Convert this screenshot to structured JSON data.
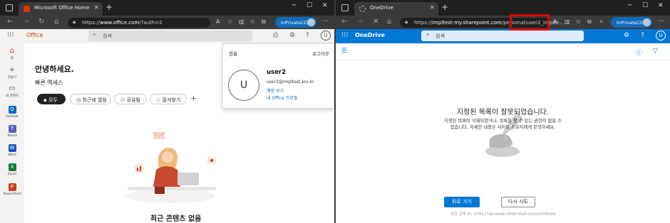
{
  "left_window": {
    "tab_title": "Microsoft Office Home",
    "url_prefix": "https://",
    "url_host": "www.office.com",
    "url_rest": "/?auth=2",
    "inprivate_label": "InPrivate(2)",
    "header": {
      "brand": "Office",
      "search_placeholder": "검색",
      "avatar_initial": "U"
    },
    "rail": [
      {
        "label": "홈",
        "icon": "home-icon",
        "color": "#d83b01"
      },
      {
        "label": "만들기",
        "icon": "add-icon",
        "color": "#555555"
      },
      {
        "label": "내 콘텐츠",
        "icon": "folder-icon",
        "color": "#555555"
      },
      {
        "label": "Outlook",
        "icon": "outlook-icon",
        "color": "#0f6cbd"
      },
      {
        "label": "Teams",
        "icon": "teams-icon",
        "color": "#5b5fc7"
      },
      {
        "label": "Word",
        "icon": "word-icon",
        "color": "#185abd"
      },
      {
        "label": "Excel",
        "icon": "excel-icon",
        "color": "#107c41"
      },
      {
        "label": "PowerPoint",
        "icon": "powerpoint-icon",
        "color": "#c43e1c"
      }
    ],
    "greeting": "안녕하세요.",
    "quick_access": "빠른 액세스",
    "chips": [
      {
        "label": "모두"
      },
      {
        "label": "최근에 열림"
      },
      {
        "label": "공유됨"
      },
      {
        "label": "즐겨찾기"
      }
    ],
    "chip_add": "+",
    "recent_empty": "최근 콘텐츠 없음",
    "account_panel": {
      "org": "염율",
      "sign_out": "로그아웃",
      "avatar_initial": "U",
      "name": "user2",
      "email": "user2@impltest.kro.kr",
      "view_account": "계정 보기",
      "my_office_profile": "내 Office 프로필"
    }
  },
  "right_window": {
    "tab_title": "OneDrive",
    "url_prefix": "https://",
    "url_host": "impltest-my.sharepoint.com",
    "url_rest": "/personal/user2_implte...",
    "inprivate_label": "InPrivate(2)",
    "header": {
      "brand": "OneDrive",
      "search_placeholder": "검색",
      "avatar_initial": "U"
    },
    "error_title": "지정된 목록이 잘못되었습니다.",
    "error_desc_line1": "지정된 목록이 삭제되었거나, 목록을 볼 수 있는 권한이 없을 수",
    "error_desc_line2": "있습니다. 자세한 내용은 사이트 소유자에게 문의하세요.",
    "back_button": "뒤로 가기",
    "retry_button": "다시 시도",
    "correlation": "상관 관계 ID: d79527a0-e0db-0000-f0e8-2b1e25f99dfe",
    "highlight_color": "#e00000"
  }
}
